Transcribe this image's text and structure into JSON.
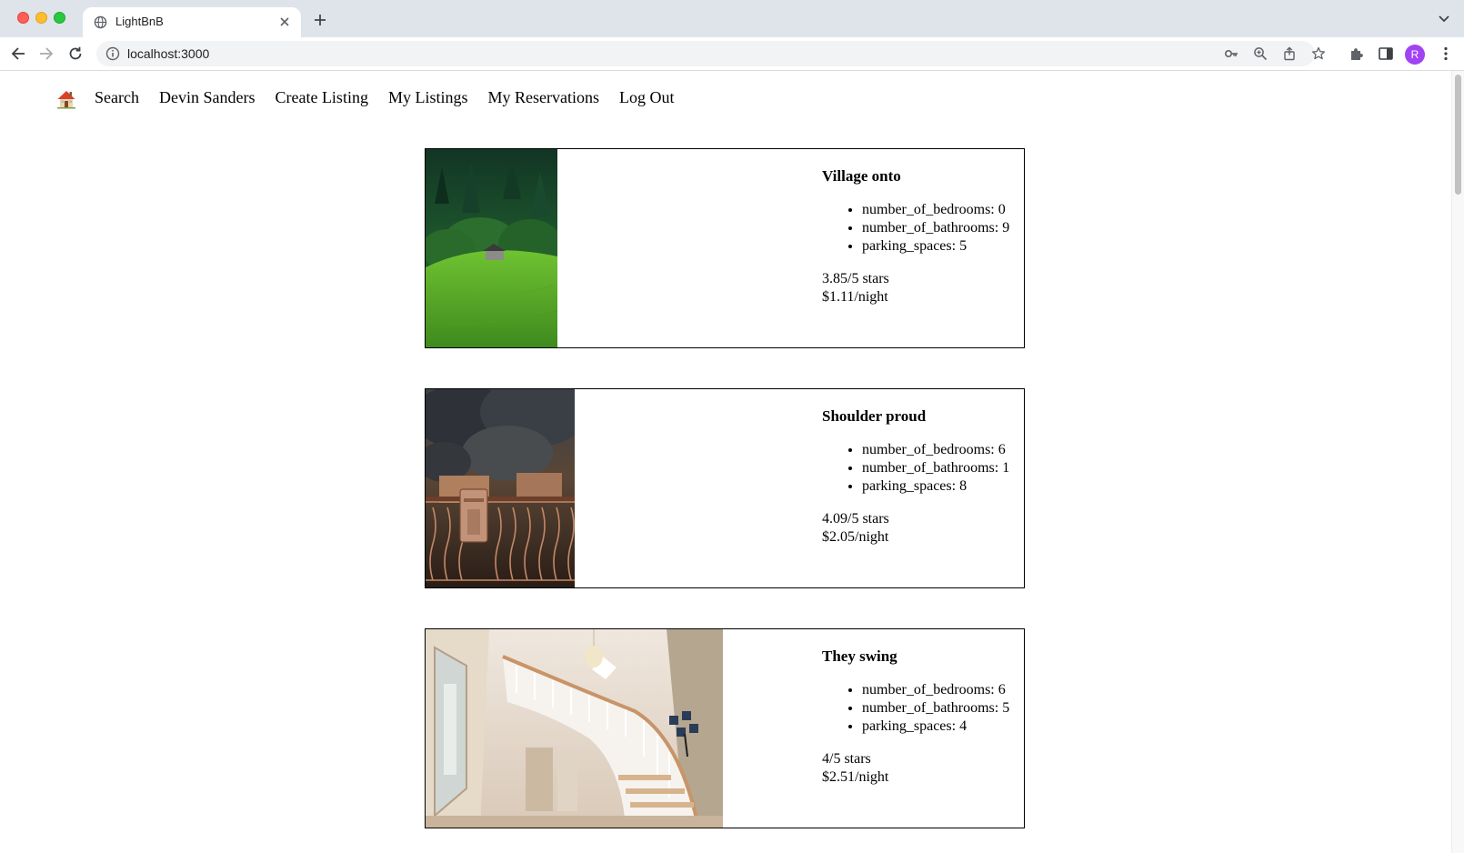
{
  "browser": {
    "tab_title": "LightBnB",
    "url": "localhost:3000",
    "avatar_letter": "R"
  },
  "nav": {
    "items": [
      "Search",
      "Devin Sanders",
      "Create Listing",
      "My Listings",
      "My Reservations",
      "Log Out"
    ]
  },
  "listings": [
    {
      "title": "Village onto",
      "bedrooms": "number_of_bedrooms: 0",
      "bathrooms": "number_of_bathrooms: 9",
      "parking": "parking_spaces: 5",
      "rating": "3.85/5 stars",
      "price": "$1.11/night"
    },
    {
      "title": "Shoulder proud",
      "bedrooms": "number_of_bedrooms: 6",
      "bathrooms": "number_of_bathrooms: 1",
      "parking": "parking_spaces: 8",
      "rating": "4.09/5 stars",
      "price": "$2.05/night"
    },
    {
      "title": "They swing",
      "bedrooms": "number_of_bedrooms: 6",
      "bathrooms": "number_of_bathrooms: 5",
      "parking": "parking_spaces: 4",
      "rating": "4/5 stars",
      "price": "$2.51/night"
    }
  ],
  "icons": {
    "home": "house-emoji-icon",
    "photo_1": "green-hillside-cabin-photo",
    "photo_2": "ornate-gate-mailbox-photo",
    "photo_3": "spiral-staircase-interior-photo"
  },
  "colors": {
    "tabstrip_bg": "#dfe3ea",
    "avatar_bg": "#a142f4"
  }
}
